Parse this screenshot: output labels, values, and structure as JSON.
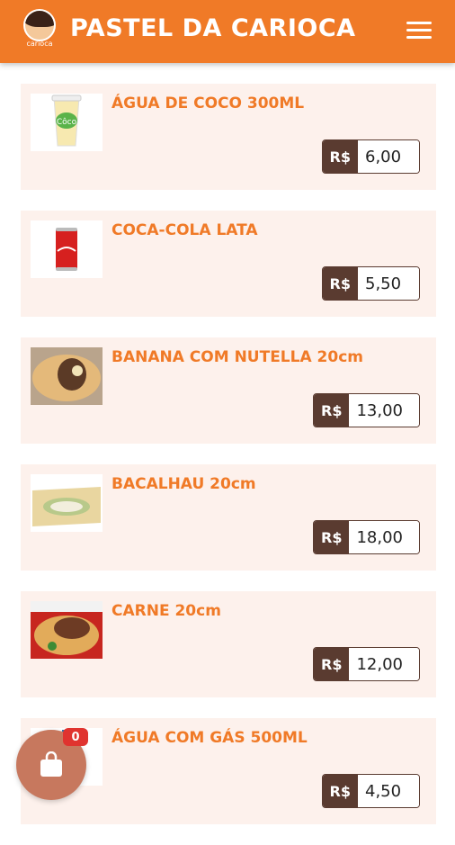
{
  "header": {
    "title": "PASTEL DA CARIOCA",
    "logo_text": "carioca"
  },
  "cart": {
    "count": "0"
  },
  "colors": {
    "accent": "#f07a27",
    "card_bg": "#fdf1ec",
    "price_dark": "#5a3b30",
    "badge": "#e0332f",
    "cart_button": "#c7785e"
  },
  "products": [
    {
      "name": "ÁGUA DE COCO 300ML",
      "currency": "R$",
      "price": "6,00",
      "image": "coconut-water-cup"
    },
    {
      "name": "COCA-COLA LATA",
      "currency": "R$",
      "price": "5,50",
      "image": "coca-cola-can"
    },
    {
      "name": "BANANA COM NUTELLA 20cm",
      "currency": "R$",
      "price": "13,00",
      "image": "pastel-banana-nutella"
    },
    {
      "name": "BACALHAU 20cm",
      "currency": "R$",
      "price": "18,00",
      "image": "pastel-bacalhau"
    },
    {
      "name": "CARNE 20cm",
      "currency": "R$",
      "price": "12,00",
      "image": "pastel-carne"
    },
    {
      "name": "ÁGUA COM GÁS 500ML",
      "currency": "R$",
      "price": "4,50",
      "image": "sparkling-water"
    }
  ]
}
